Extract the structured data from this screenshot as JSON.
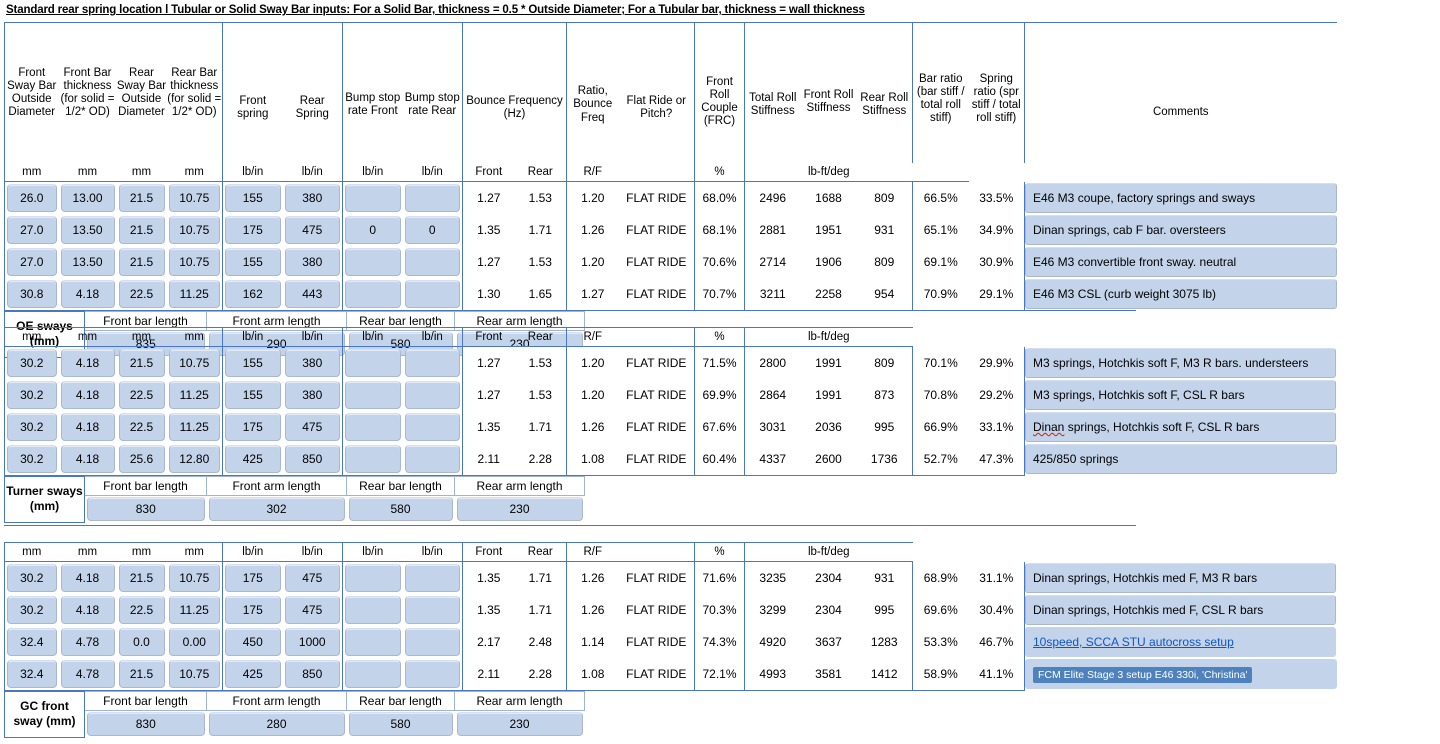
{
  "title": "Standard rear spring location l Tubular or Solid Sway Bar inputs: For a Solid Bar, thickness = 0.5 * Outside Diameter; For a Tubular bar, thickness = wall thickness",
  "colors": {
    "input_fill": "#c3d3ea",
    "grid_blue": "#4a77c4",
    "link": "#1155cc",
    "selection": "#4f81bd"
  },
  "header": {
    "groups": [
      {
        "columns": [
          {
            "label": "Front Sway Bar Outside Diameter",
            "unit": "mm"
          },
          {
            "label": "Front Bar thickness (for solid = 1/2* OD)",
            "unit": "mm"
          },
          {
            "label": "Rear Sway Bar Outside Diameter",
            "unit": "mm"
          },
          {
            "label": "Rear Bar thickness (for solid = 1/2* OD)",
            "unit": "mm"
          }
        ]
      },
      {
        "columns": [
          {
            "label": "Front spring",
            "unit": "lb/in"
          },
          {
            "label": "Rear Spring",
            "unit": "lb/in"
          }
        ]
      },
      {
        "columns": [
          {
            "label": "Bump stop rate Front",
            "unit": "lb/in"
          },
          {
            "label": "Bump stop rate Rear",
            "unit": "lb/in"
          }
        ]
      },
      {
        "span_label": "Bounce Frequency (Hz)",
        "columns": [
          {
            "label": "",
            "unit": "Front"
          },
          {
            "label": "",
            "unit": "Rear"
          }
        ]
      },
      {
        "columns": [
          {
            "label": "Ratio, Bounce Freq",
            "unit": "R/F"
          },
          {
            "label": "Flat Ride or Pitch?",
            "unit": ""
          }
        ]
      },
      {
        "columns": [
          {
            "label": "Front Roll Couple (FRC)",
            "unit": "%"
          }
        ]
      },
      {
        "span_label": "lb-ft/deg",
        "columns": [
          {
            "label": "Total Roll Stiffness",
            "unit": ""
          },
          {
            "label": "Front Roll Stiffness",
            "unit": ""
          },
          {
            "label": "Rear Roll Stiffness",
            "unit": ""
          }
        ]
      },
      {
        "columns": [
          {
            "label": "Bar ratio (bar stiff / total roll stiff)",
            "unit": "%"
          },
          {
            "label": "Spring ratio (spr stiff / total roll stiff)",
            "unit": "%"
          }
        ]
      },
      {
        "columns": [
          {
            "label": "Comments",
            "unit": ""
          }
        ]
      }
    ],
    "units_row": [
      "mm",
      "mm",
      "mm",
      "mm",
      "lb/in",
      "lb/in",
      "lb/in",
      "lb/in",
      "Front",
      "Rear",
      "R/F",
      "",
      "%",
      "lb-ft/deg",
      "%",
      "%"
    ]
  },
  "blocks": [
    {
      "id": "oe",
      "rows": [
        {
          "front_bar_od": "26.0",
          "front_bar_thk": "13.00",
          "rear_bar_od": "21.5",
          "rear_bar_thk": "10.75",
          "front_spring": "155",
          "rear_spring": "380",
          "bump_front": "",
          "bump_rear": "",
          "bounce_front": "1.27",
          "bounce_rear": "1.53",
          "ratio": "1.20",
          "flat_ride": "FLAT RIDE",
          "frc": "68.0%",
          "total_roll": "2496",
          "front_roll": "1688",
          "rear_roll": "809",
          "bar_ratio": "66.5%",
          "spring_ratio": "33.5%",
          "comment": "E46 M3 coupe, factory springs and sways",
          "comment_style": "plain"
        },
        {
          "front_bar_od": "27.0",
          "front_bar_thk": "13.50",
          "rear_bar_od": "21.5",
          "rear_bar_thk": "10.75",
          "front_spring": "175",
          "rear_spring": "475",
          "bump_front": "0",
          "bump_rear": "0",
          "bounce_front": "1.35",
          "bounce_rear": "1.71",
          "ratio": "1.26",
          "flat_ride": "FLAT RIDE",
          "frc": "68.1%",
          "total_roll": "2881",
          "front_roll": "1951",
          "rear_roll": "931",
          "bar_ratio": "65.1%",
          "spring_ratio": "34.9%",
          "comment": "Dinan springs, cab F bar. oversteers",
          "comment_style": "plain"
        },
        {
          "front_bar_od": "27.0",
          "front_bar_thk": "13.50",
          "rear_bar_od": "21.5",
          "rear_bar_thk": "10.75",
          "front_spring": "155",
          "rear_spring": "380",
          "bump_front": "",
          "bump_rear": "",
          "bounce_front": "1.27",
          "bounce_rear": "1.53",
          "ratio": "1.20",
          "flat_ride": "FLAT RIDE",
          "frc": "70.6%",
          "total_roll": "2714",
          "front_roll": "1906",
          "rear_roll": "809",
          "bar_ratio": "69.1%",
          "spring_ratio": "30.9%",
          "comment": "E46 M3 convertible front sway. neutral",
          "comment_style": "plain"
        },
        {
          "front_bar_od": "30.8",
          "front_bar_thk": "4.18",
          "rear_bar_od": "22.5",
          "rear_bar_thk": "11.25",
          "front_spring": "162",
          "rear_spring": "443",
          "bump_front": "",
          "bump_rear": "",
          "bounce_front": "1.30",
          "bounce_rear": "1.65",
          "ratio": "1.27",
          "flat_ride": "FLAT RIDE",
          "frc": "70.7%",
          "total_roll": "3211",
          "front_roll": "2258",
          "rear_roll": "954",
          "bar_ratio": "70.9%",
          "spring_ratio": "29.1%",
          "comment": "E46 M3 CSL (curb weight 3075 lb)",
          "comment_style": "plain"
        }
      ],
      "sub": {
        "label": "OE sways (mm)",
        "headers": [
          "Front bar length",
          "Front arm length",
          "Rear bar length",
          "Rear arm length"
        ],
        "values": [
          "835",
          "290",
          "580",
          "230"
        ]
      }
    },
    {
      "id": "turner",
      "rows": [
        {
          "front_bar_od": "30.2",
          "front_bar_thk": "4.18",
          "rear_bar_od": "21.5",
          "rear_bar_thk": "10.75",
          "front_spring": "155",
          "rear_spring": "380",
          "bump_front": "",
          "bump_rear": "",
          "bounce_front": "1.27",
          "bounce_rear": "1.53",
          "ratio": "1.20",
          "flat_ride": "FLAT RIDE",
          "frc": "71.5%",
          "total_roll": "2800",
          "front_roll": "1991",
          "rear_roll": "809",
          "bar_ratio": "70.1%",
          "spring_ratio": "29.9%",
          "comment": "M3 springs, Hotchkis soft F, M3 R bars. understeers",
          "comment_style": "plain"
        },
        {
          "front_bar_od": "30.2",
          "front_bar_thk": "4.18",
          "rear_bar_od": "22.5",
          "rear_bar_thk": "11.25",
          "front_spring": "155",
          "rear_spring": "380",
          "bump_front": "",
          "bump_rear": "",
          "bounce_front": "1.27",
          "bounce_rear": "1.53",
          "ratio": "1.20",
          "flat_ride": "FLAT RIDE",
          "frc": "69.9%",
          "total_roll": "2864",
          "front_roll": "1991",
          "rear_roll": "873",
          "bar_ratio": "70.8%",
          "spring_ratio": "29.2%",
          "comment": "M3 springs, Hotchkis soft F, CSL R bars",
          "comment_style": "plain"
        },
        {
          "front_bar_od": "30.2",
          "front_bar_thk": "4.18",
          "rear_bar_od": "22.5",
          "rear_bar_thk": "11.25",
          "front_spring": "175",
          "rear_spring": "475",
          "bump_front": "",
          "bump_rear": "",
          "bounce_front": "1.35",
          "bounce_rear": "1.71",
          "ratio": "1.26",
          "flat_ride": "FLAT RIDE",
          "frc": "67.6%",
          "total_roll": "3031",
          "front_roll": "2036",
          "rear_roll": "995",
          "bar_ratio": "66.9%",
          "spring_ratio": "33.1%",
          "comment": "Dinan springs, Hotchkis soft F, CSL R bars",
          "comment_style": "misspelled-first-word"
        },
        {
          "front_bar_od": "30.2",
          "front_bar_thk": "4.18",
          "rear_bar_od": "25.6",
          "rear_bar_thk": "12.80",
          "front_spring": "425",
          "rear_spring": "850",
          "bump_front": "",
          "bump_rear": "",
          "bounce_front": "2.11",
          "bounce_rear": "2.28",
          "ratio": "1.08",
          "flat_ride": "FLAT RIDE",
          "frc": "60.4%",
          "total_roll": "4337",
          "front_roll": "2600",
          "rear_roll": "1736",
          "bar_ratio": "52.7%",
          "spring_ratio": "47.3%",
          "comment": "425/850 springs",
          "comment_style": "plain"
        }
      ],
      "sub": {
        "label": "Turner sways (mm)",
        "headers": [
          "Front bar length",
          "Front arm length",
          "Rear bar length",
          "Rear arm length"
        ],
        "values": [
          "830",
          "302",
          "580",
          "230"
        ]
      }
    },
    {
      "id": "gc",
      "rows": [
        {
          "front_bar_od": "30.2",
          "front_bar_thk": "4.18",
          "rear_bar_od": "21.5",
          "rear_bar_thk": "10.75",
          "front_spring": "175",
          "rear_spring": "475",
          "bump_front": "",
          "bump_rear": "",
          "bounce_front": "1.35",
          "bounce_rear": "1.71",
          "ratio": "1.26",
          "flat_ride": "FLAT RIDE",
          "frc": "71.6%",
          "total_roll": "3235",
          "front_roll": "2304",
          "rear_roll": "931",
          "bar_ratio": "68.9%",
          "spring_ratio": "31.1%",
          "comment": "Dinan springs, Hotchkis med F, M3 R bars",
          "comment_style": "plain"
        },
        {
          "front_bar_od": "30.2",
          "front_bar_thk": "4.18",
          "rear_bar_od": "22.5",
          "rear_bar_thk": "11.25",
          "front_spring": "175",
          "rear_spring": "475",
          "bump_front": "",
          "bump_rear": "",
          "bounce_front": "1.35",
          "bounce_rear": "1.71",
          "ratio": "1.26",
          "flat_ride": "FLAT RIDE",
          "frc": "70.3%",
          "total_roll": "3299",
          "front_roll": "2304",
          "rear_roll": "995",
          "bar_ratio": "69.6%",
          "spring_ratio": "30.4%",
          "comment": "Dinan springs, Hotchkis med F, CSL R bars",
          "comment_style": "plain"
        },
        {
          "front_bar_od": "32.4",
          "front_bar_thk": "4.78",
          "rear_bar_od": "0.0",
          "rear_bar_thk": "0.00",
          "front_spring": "450",
          "rear_spring": "1000",
          "bump_front": "",
          "bump_rear": "",
          "bounce_front": "2.17",
          "bounce_rear": "2.48",
          "ratio": "1.14",
          "flat_ride": "FLAT RIDE",
          "frc": "74.3%",
          "total_roll": "4920",
          "front_roll": "3637",
          "rear_roll": "1283",
          "bar_ratio": "53.3%",
          "spring_ratio": "46.7%",
          "comment": "10speed, SCCA STU autocross setup",
          "comment_style": "link"
        },
        {
          "front_bar_od": "32.4",
          "front_bar_thk": "4.78",
          "rear_bar_od": "21.5",
          "rear_bar_thk": "10.75",
          "front_spring": "425",
          "rear_spring": "850",
          "bump_front": "",
          "bump_rear": "",
          "bounce_front": "2.11",
          "bounce_rear": "2.28",
          "ratio": "1.08",
          "flat_ride": "FLAT RIDE",
          "frc": "72.1%",
          "total_roll": "4993",
          "front_roll": "3581",
          "rear_roll": "1412",
          "bar_ratio": "58.9%",
          "spring_ratio": "41.1%",
          "comment": "FCM Elite Stage 3 setup E46 330i, 'Christina'",
          "comment_style": "selected"
        }
      ],
      "sub": {
        "label": "GC front sway (mm)",
        "headers": [
          "Front bar length",
          "Front arm length",
          "Rear bar length",
          "Rear arm length"
        ],
        "values": [
          "830",
          "280",
          "580",
          "230"
        ]
      }
    }
  ]
}
